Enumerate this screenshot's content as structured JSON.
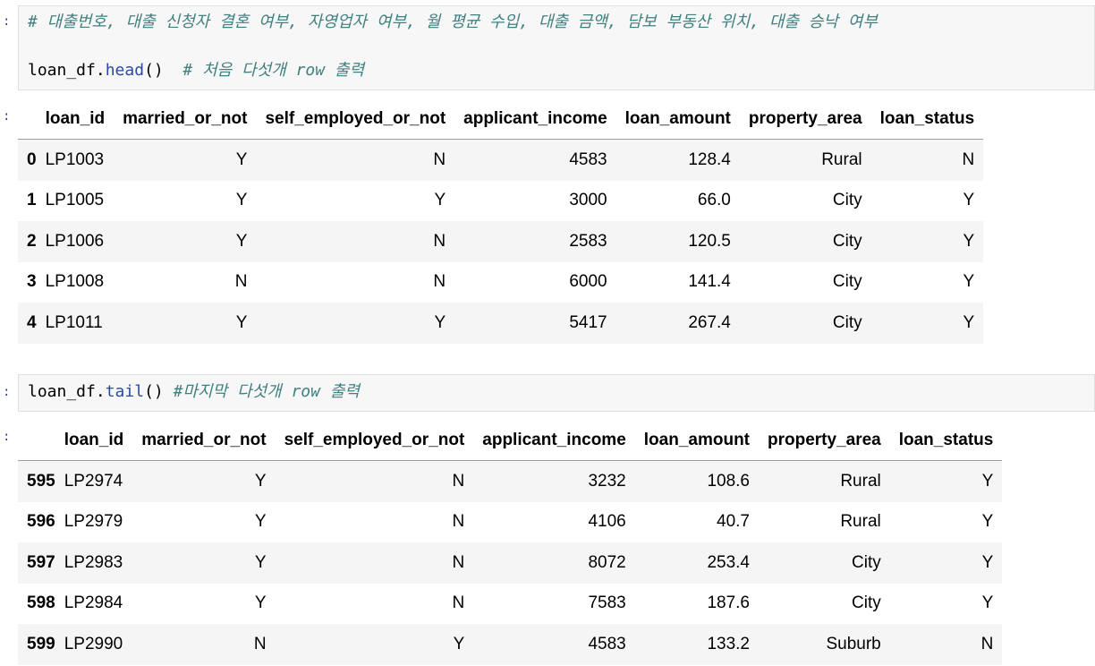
{
  "cell1": {
    "prompt": ":",
    "comment_line": "# 대출번호, 대출 신청자 결혼 여부, 자영업자 여부, 월 평균 수입, 대출 금액, 담보 부동산 위치, 대출 승낙 여부",
    "code_var": "loan_df",
    "code_dot": ".",
    "code_method": "head",
    "code_parens": "()",
    "code_comment": "  # 처음 다섯개 row 출력"
  },
  "out1": {
    "prompt": ":",
    "columns": [
      "",
      "loan_id",
      "married_or_not",
      "self_employed_or_not",
      "applicant_income",
      "loan_amount",
      "property_area",
      "loan_status"
    ],
    "rows": [
      {
        "index": "0",
        "cells": [
          "LP1003",
          "Y",
          "N",
          "4583",
          "128.4",
          "Rural",
          "N"
        ]
      },
      {
        "index": "1",
        "cells": [
          "LP1005",
          "Y",
          "Y",
          "3000",
          "66.0",
          "City",
          "Y"
        ]
      },
      {
        "index": "2",
        "cells": [
          "LP1006",
          "Y",
          "N",
          "2583",
          "120.5",
          "City",
          "Y"
        ]
      },
      {
        "index": "3",
        "cells": [
          "LP1008",
          "N",
          "N",
          "6000",
          "141.4",
          "City",
          "Y"
        ]
      },
      {
        "index": "4",
        "cells": [
          "LP1011",
          "Y",
          "Y",
          "5417",
          "267.4",
          "City",
          "Y"
        ]
      }
    ]
  },
  "cell2": {
    "prompt": ":",
    "code_var": "loan_df",
    "code_dot": ".",
    "code_method": "tail",
    "code_parens": "()",
    "code_comment": " #마지막 다섯개 row 출력"
  },
  "out2": {
    "prompt": ":",
    "columns": [
      "",
      "loan_id",
      "married_or_not",
      "self_employed_or_not",
      "applicant_income",
      "loan_amount",
      "property_area",
      "loan_status"
    ],
    "rows": [
      {
        "index": "595",
        "cells": [
          "LP2974",
          "Y",
          "N",
          "3232",
          "108.6",
          "Rural",
          "Y"
        ]
      },
      {
        "index": "596",
        "cells": [
          "LP2979",
          "Y",
          "N",
          "4106",
          "40.7",
          "Rural",
          "Y"
        ]
      },
      {
        "index": "597",
        "cells": [
          "LP2983",
          "Y",
          "N",
          "8072",
          "253.4",
          "City",
          "Y"
        ]
      },
      {
        "index": "598",
        "cells": [
          "LP2984",
          "Y",
          "N",
          "7583",
          "187.6",
          "City",
          "Y"
        ]
      },
      {
        "index": "599",
        "cells": [
          "LP2990",
          "N",
          "Y",
          "4583",
          "133.2",
          "Suburb",
          "N"
        ]
      }
    ]
  }
}
